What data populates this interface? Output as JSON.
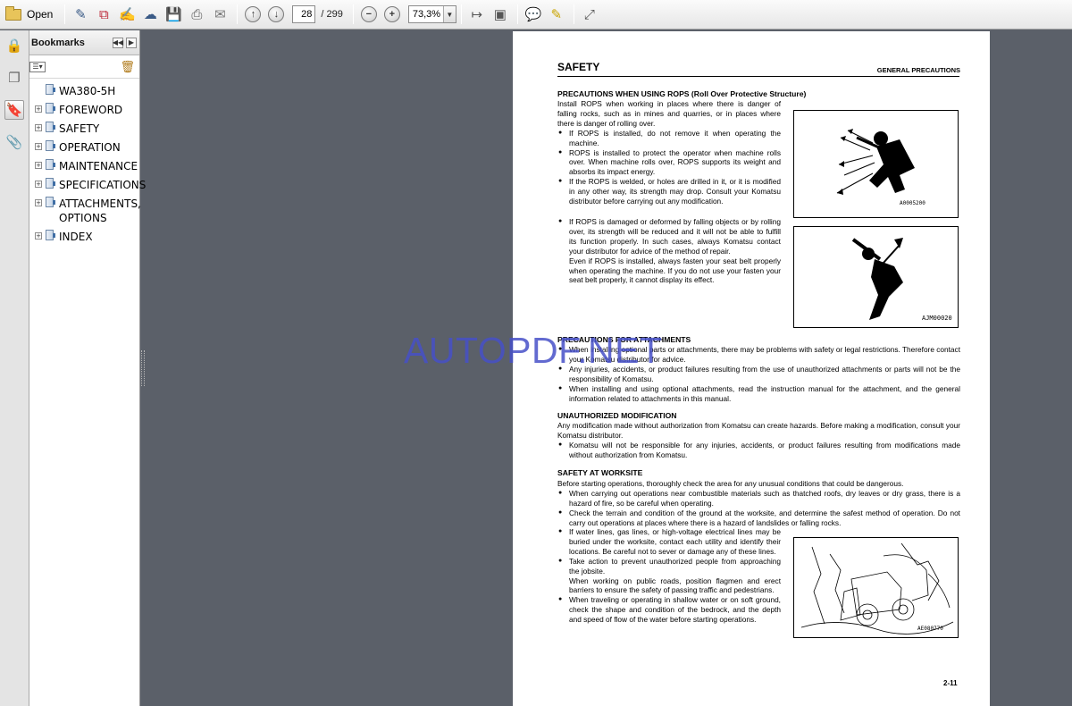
{
  "toolbar": {
    "open_label": "Open",
    "page_current": "28",
    "page_total": "/ 299",
    "zoom_value": "73,3%"
  },
  "bookmarks": {
    "title": "Bookmarks",
    "items": [
      {
        "label": "WA380-5H",
        "expandable": false
      },
      {
        "label": "FOREWORD",
        "expandable": true
      },
      {
        "label": "SAFETY",
        "expandable": true
      },
      {
        "label": "OPERATION",
        "expandable": true
      },
      {
        "label": "MAINTENANCE",
        "expandable": true
      },
      {
        "label": "SPECIFICATIONS",
        "expandable": true
      },
      {
        "label": "ATTACHMENTS, OPTIONS",
        "expandable": true
      },
      {
        "label": "INDEX",
        "expandable": true
      }
    ]
  },
  "watermark": "AUTOPDF.NET",
  "doc": {
    "title": "SAFETY",
    "header_right": "GENERAL PRECAUTIONS",
    "rops": {
      "heading": "PRECAUTIONS WHEN USING ROPS (Roll Over Protective Structure)",
      "intro": "Install ROPS when working in places where there is danger of falling rocks, such as in mines and quarries, or in places where there is danger of rolling over.",
      "bullets": [
        "If ROPS is installed, do not remove it when operating the machine.",
        "ROPS is installed to protect the operator when machine rolls over. When machine rolls over, ROPS supports its weight and absorbs its impact energy.",
        "If the ROPS is welded, or holes are drilled in it, or it is modified in any other way, its strength may drop. Consult your Komatsu distributor before carrying out any modification."
      ],
      "bullet4": "If ROPS is damaged or deformed by falling objects or by rolling over, its strength will be reduced and it will not be able to fulfill its function properly. In such cases, always Komatsu contact your distributor for advice of the method of repair.",
      "bullet4_cont": "Even if ROPS is installed, always fasten your seat belt properly when operating the machine. If you do not use your fasten your seat belt properly, it cannot display its effect.",
      "fig1_caption": "A0005200",
      "fig2_caption": "AJM00020"
    },
    "attachments": {
      "heading": "PRECAUTIONS FOR ATTACHMENTS",
      "bullets": [
        "When installing optional parts or attachments, there may be problems with safety or legal restrictions. Therefore contact your Komatsu distributor for advice.",
        "Any injuries, accidents, or product failures resulting from the use of unauthorized attachments or parts will not be the responsibility of Komatsu.",
        "When installing and using optional attachments, read the instruction manual for the attachment, and the general information related to attachments in this manual."
      ]
    },
    "modification": {
      "heading": "UNAUTHORIZED MODIFICATION",
      "intro": "Any modification made without authorization from Komatsu can create hazards. Before making a modification, consult your Komatsu distributor.",
      "bullets": [
        "Komatsu will not be responsible for any injuries, accidents, or product failures resulting from modifications made without authorization from Komatsu."
      ]
    },
    "worksite": {
      "heading": "SAFETY AT WORKSITE",
      "intro": "Before starting operations, thoroughly check the area for any unusual conditions that could be dangerous.",
      "bullets_wide": [
        "When carrying out operations near combustible materials such as thatched roofs, dry leaves or dry grass, there is a hazard of fire, so be careful when operating.",
        "Check the terrain and condition of the ground at the worksite, and determine the safest method of operation. Do not carry out operations at places where there is a hazard of landslides or falling rocks."
      ],
      "bullets_narrow": [
        "If water lines, gas lines, or high-voltage electrical lines may be buried under the worksite, contact each utility and identify their locations. Be careful not to sever or damage any of these lines.",
        "Take action to prevent unauthorized people from approaching the jobsite.",
        "When traveling or operating in shallow water or on soft ground, check the shape and condition of the bedrock, and the depth and speed of flow of the water before starting operations."
      ],
      "jobsite_cont": "When working on public roads, position flagmen and erect barriers to ensure the safety of passing traffic and pedestrians.",
      "fig3_caption": "AE080770"
    },
    "page_number": "2-11"
  }
}
